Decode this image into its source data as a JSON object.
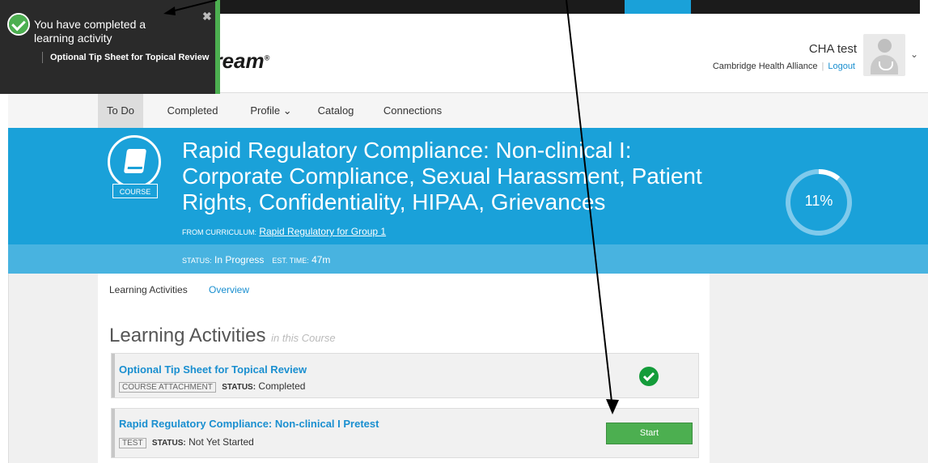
{
  "header": {
    "logo_text": "HealthStream",
    "user_name": "CHA test",
    "organization": "Cambridge Health Alliance",
    "logout_label": "Logout"
  },
  "nav": {
    "items": [
      {
        "label": "To Do",
        "active": true
      },
      {
        "label": "Completed",
        "active": false
      },
      {
        "label": "Profile ⌄",
        "active": false
      },
      {
        "label": "Catalog",
        "active": false
      },
      {
        "label": "Connections",
        "active": false
      }
    ]
  },
  "course": {
    "badge": "COURSE",
    "title": "Rapid Regulatory Compliance: Non-clinical I: Corporate Compliance, Sexual Harassment, Patient Rights, Confidentiality, HIPAA, Grievances",
    "curriculum_label": "FROM CURRICULUM:",
    "curriculum_name": "Rapid Regulatory for Group 1",
    "progress_percent": 11,
    "progress_text": "11%",
    "status_label": "STATUS:",
    "status_value": "In Progress",
    "est_time_label": "EST. TIME:",
    "est_time_value": "47m"
  },
  "subtabs": {
    "learning_activities": "Learning Activities",
    "overview": "Overview"
  },
  "section": {
    "title": "Learning Activities",
    "subtitle": "in this Course"
  },
  "activities": [
    {
      "title": "Optional Tip Sheet for Topical Review",
      "type": "COURSE ATTACHMENT",
      "status_label": "STATUS:",
      "status": "Completed",
      "action": "completed-check"
    },
    {
      "title": "Rapid Regulatory Compliance: Non-clinical I Pretest",
      "type": "TEST",
      "status_label": "STATUS:",
      "status": "Not Yet Started",
      "action_label": "Start"
    }
  ],
  "toast": {
    "title": "You have completed a learning activity",
    "activity": "Optional Tip Sheet for Topical Review",
    "close_glyph": "✖"
  },
  "colors": {
    "brand_blue": "#1aa1d9",
    "link_blue": "#1a8fd0",
    "success_green": "#4caf50",
    "logo_red": "#b71c2c"
  }
}
